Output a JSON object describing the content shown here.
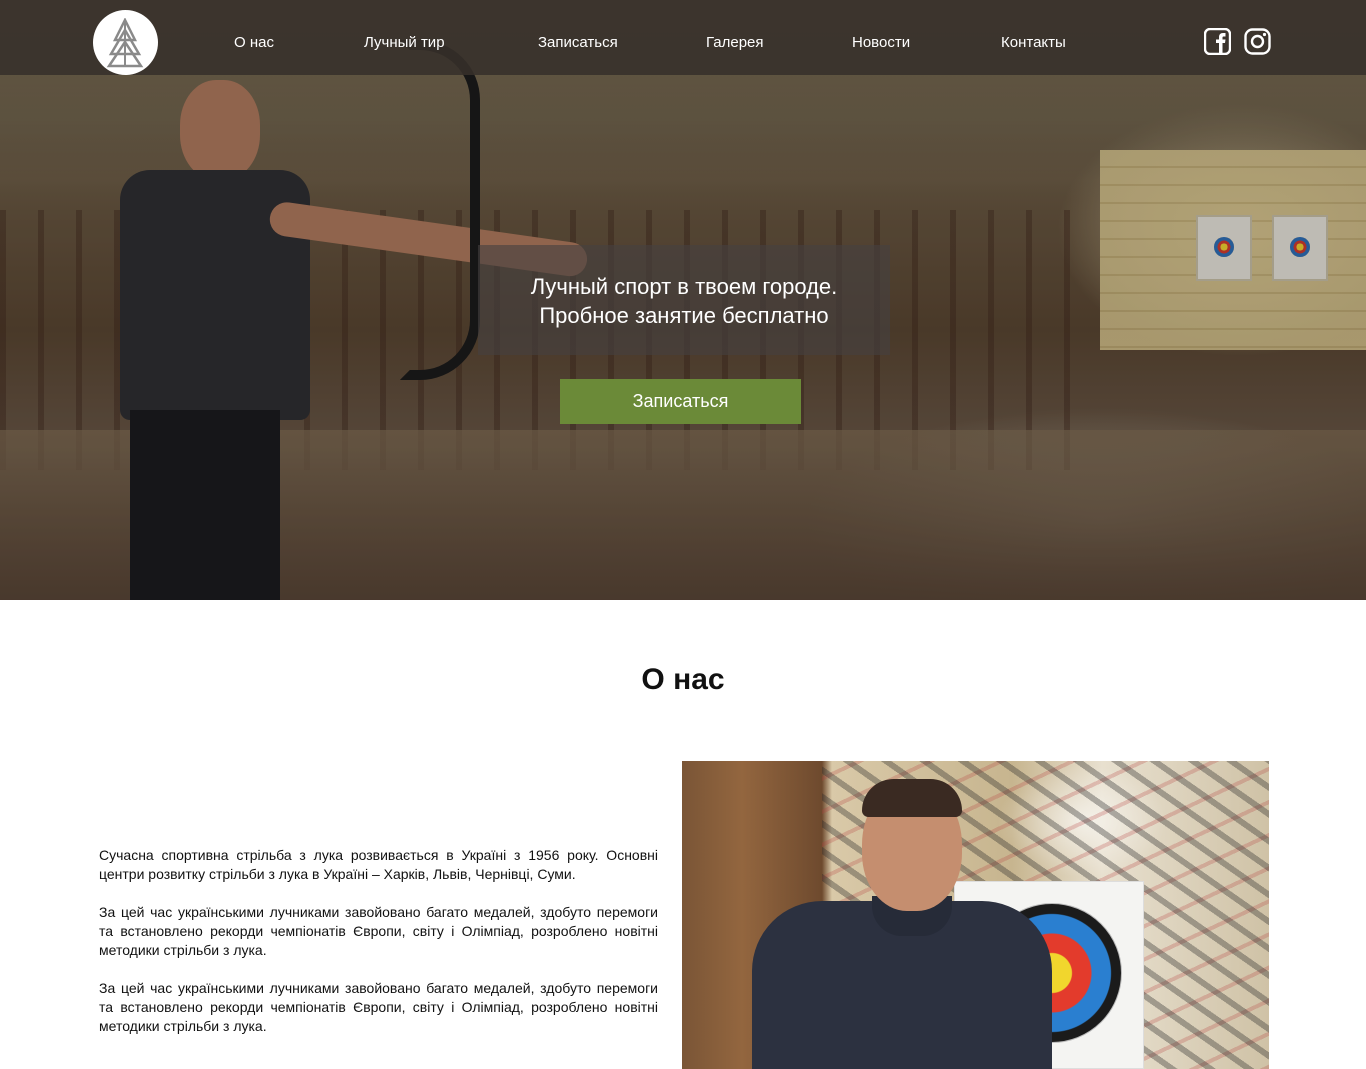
{
  "navbar": {
    "links": [
      "О нас",
      "Лучный тир",
      "Записаться",
      "Галерея",
      "Новости",
      "Контакты"
    ]
  },
  "icons": {
    "logo": "archery-arrow-logo",
    "social": [
      "facebook-icon",
      "instagram-icon"
    ]
  },
  "hero": {
    "line1": "Лучный спорт в твоем городе.",
    "line2": "Пробное занятие бесплатно",
    "button_label": "Записаться"
  },
  "about": {
    "title": "О нас",
    "paragraphs": [
      "Сучасна спортивна стрільба з лука розвивається в Україні з 1956 року. Основні центри розвитку стрільби з лука в Україні – Харків, Львів, Чернівці, Суми.",
      "За цей час українськими лучниками завойовано багато медалей, здобуто перемоги та встановлено рекорди чемпіонатів Європи, світу і Олімпіад, розроблено новітні методики стрільби з лука.",
      "За цей час українськими лучниками завойовано багато медалей, здобуто перемоги та встановлено рекорди чемпіонатів Європи, світу і Олімпіад, розроблено новітні методики стрільби з лука."
    ]
  },
  "colors": {
    "nav_background": "#37302a",
    "accent_button": "#6b8a38",
    "hero_caption_background": "#464141",
    "text": "#111111"
  }
}
